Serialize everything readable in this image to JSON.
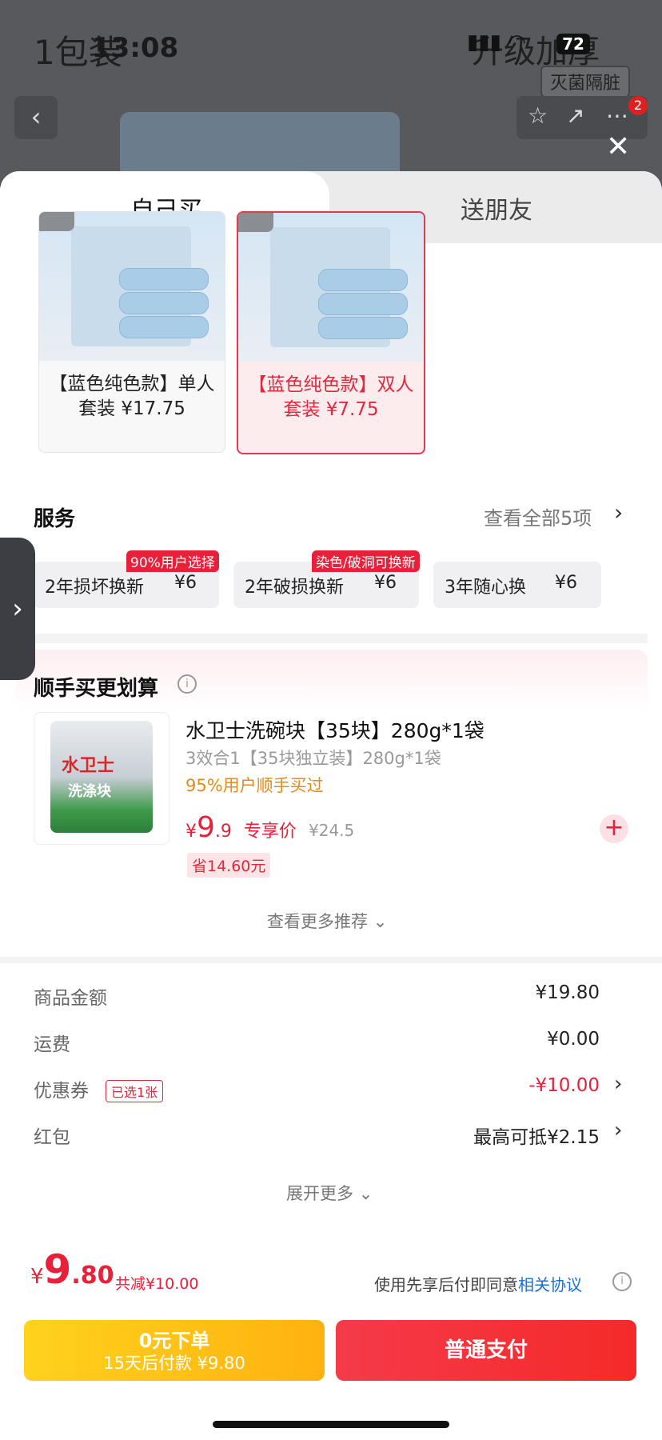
{
  "status_bar": {
    "time": "13:08",
    "battery": "72"
  },
  "background_page": {
    "title_left": "1包装",
    "title_right": "升级加厚",
    "tag": "灭菌隔脏",
    "cart_badge": "2"
  },
  "tabs": [
    {
      "label": "自己买"
    },
    {
      "label": "送朋友"
    }
  ],
  "options": [
    {
      "label_line1": "【蓝色纯色款】单人",
      "label_line2": "套装 ¥17.75",
      "selected": false
    },
    {
      "label_line1": "【蓝色纯色款】双人",
      "label_line2": "套装 ¥7.75",
      "selected": true
    }
  ],
  "services": {
    "title": "服务",
    "view_all": "查看全部5项",
    "items": [
      {
        "name": "2年损坏换新",
        "price": "¥6",
        "badge": "90%用户选择"
      },
      {
        "name": "2年破损换新",
        "price": "¥6",
        "badge": "染色/破洞可换新"
      },
      {
        "name": "3年随心换",
        "price": "¥6",
        "badge": ""
      }
    ]
  },
  "addon": {
    "section_title": "顺手买更划算",
    "brand_text": "水卫士",
    "pack_text": "洗涤块",
    "name": "水卫士洗碗块【35块】280g*1袋",
    "subtitle": "3效合1【35块独立装】280g*1袋",
    "hint": "95%用户顺手买过",
    "price_symbol": "¥",
    "price_int": "9",
    "price_dec": ".9",
    "price_label": "专享价",
    "old_price": "¥24.5",
    "save": "省14.60元",
    "more": "查看更多推荐"
  },
  "summary": {
    "goods_label": "商品金额",
    "goods_value": "¥19.80",
    "shipping_label": "运费",
    "shipping_value": "¥0.00",
    "coupon_label": "优惠券",
    "coupon_tag": "已选1张",
    "coupon_value": "-¥10.00",
    "redpacket_label": "红包",
    "redpacket_value": "最高可抵¥2.15",
    "expand": "展开更多"
  },
  "footer": {
    "symbol": "¥",
    "total_int": "9",
    "total_dec": ".80",
    "total_save": "共减¥10.00",
    "agree_text": "使用先享后付即同意",
    "agree_link": "相关协议",
    "btn_later_l1": "0元下单",
    "btn_later_l2": "15天后付款 ¥9.80",
    "btn_pay": "普通支付"
  },
  "colors": {
    "accent": "#e8203a",
    "yellow": "#ffc21a",
    "link": "#1a6fd8"
  }
}
